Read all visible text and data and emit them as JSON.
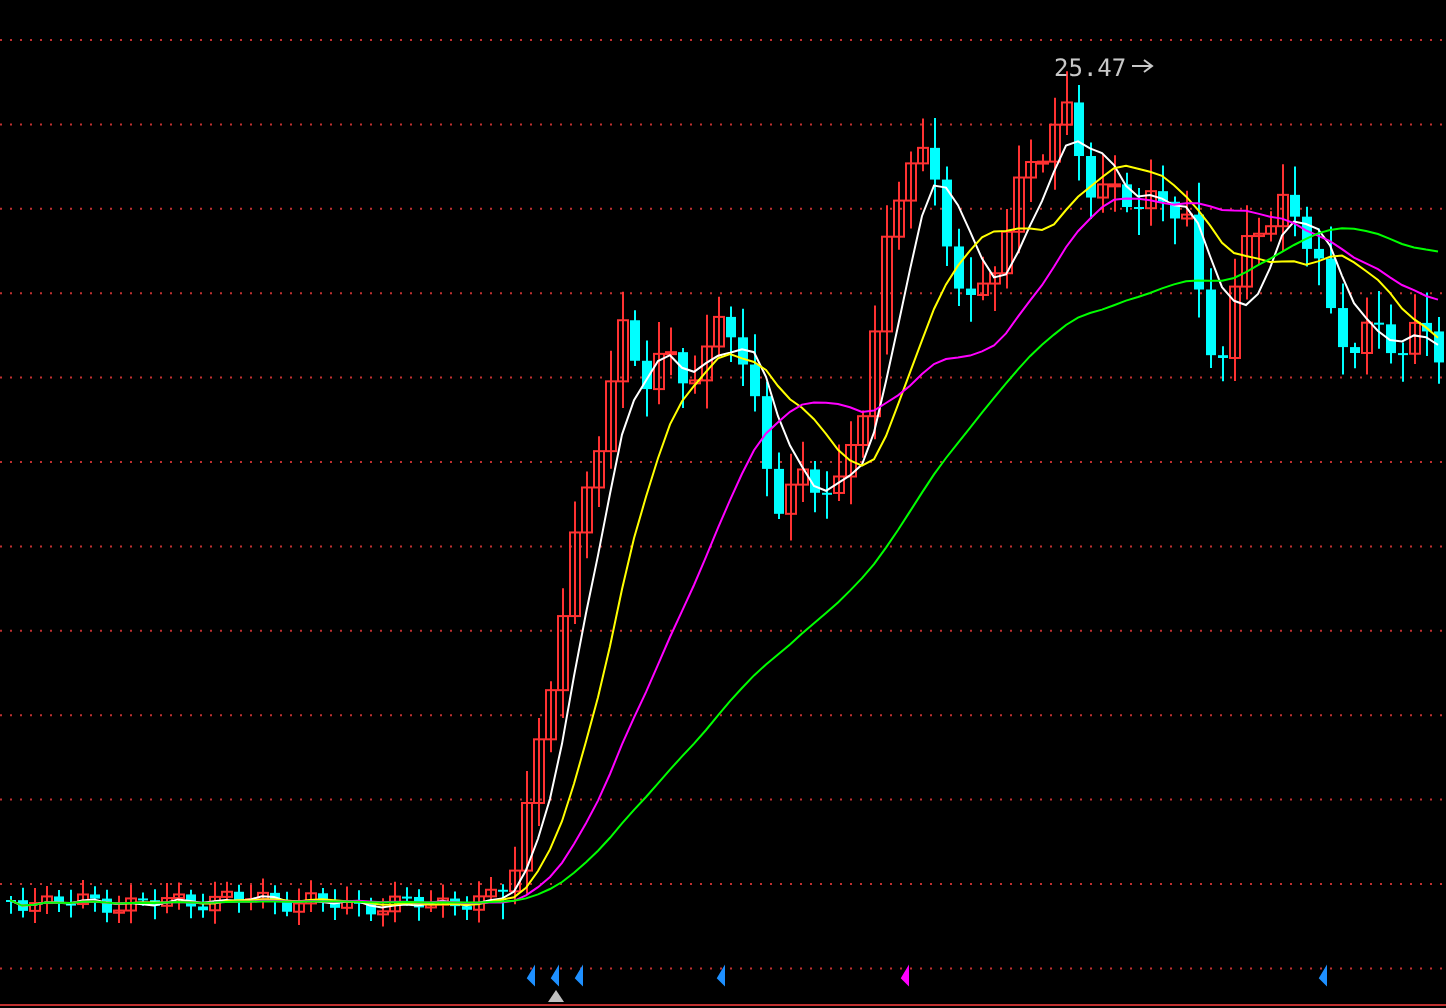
{
  "chart": {
    "peak_label": "25.47"
  }
}
